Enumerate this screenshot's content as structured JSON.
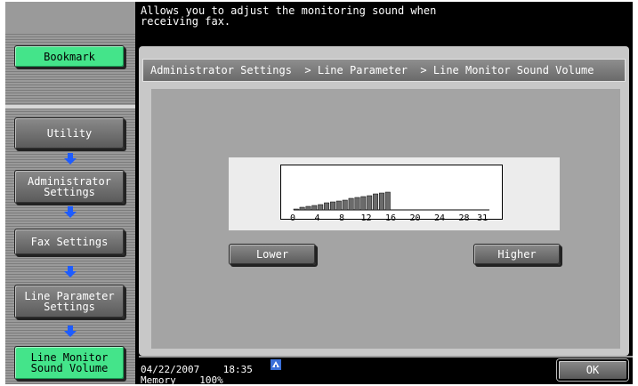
{
  "header": {
    "message": "Allows you to adjust the monitoring sound when\nreceiving fax."
  },
  "sidebar": {
    "bookmark_label": "Bookmark",
    "items": [
      {
        "label": "Utility"
      },
      {
        "label": "Administrator\nSettings"
      },
      {
        "label": "Fax Settings"
      },
      {
        "label": "Line Parameter\nSettings"
      },
      {
        "label": "Line Monitor\nSound Volume"
      }
    ]
  },
  "breadcrumb": {
    "text": "Administrator Settings  > Line Parameter  > Line Monitor Sound Volume"
  },
  "volume": {
    "level": 16,
    "max": 31,
    "tick_labels": [
      "0",
      "4",
      "8",
      "12",
      "16",
      "20",
      "24",
      "28",
      "31"
    ],
    "lower_label": "Lower",
    "higher_label": "Higher"
  },
  "footer": {
    "date": "04/22/2007",
    "time": "18:35",
    "memory_label": "Memory",
    "memory_value": "100%",
    "ok_label": "OK"
  },
  "colors": {
    "accent_green": "#44e48a",
    "arrow_blue": "#1e5cff",
    "background": "#000000"
  }
}
